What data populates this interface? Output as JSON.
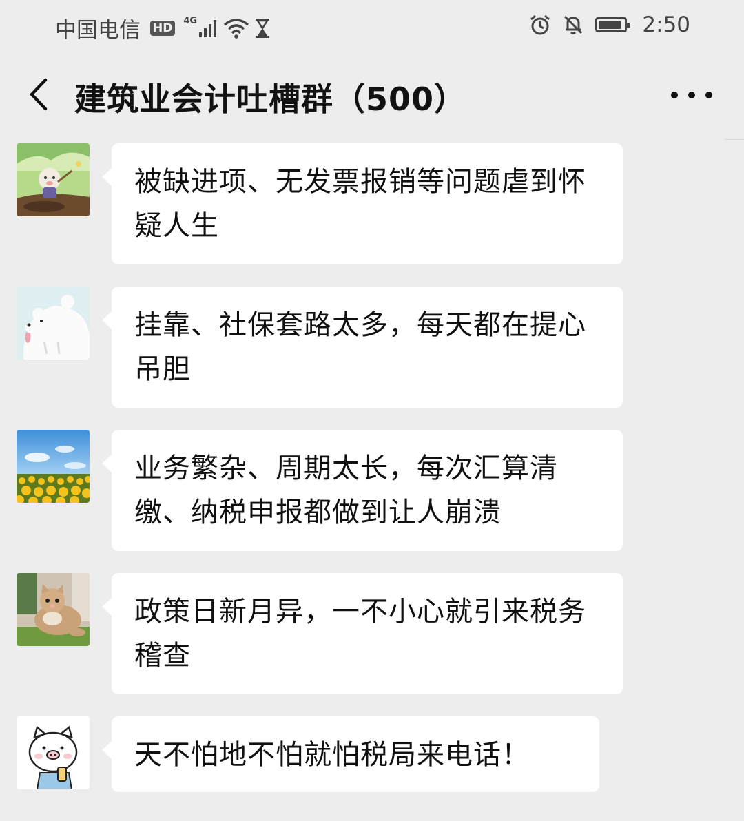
{
  "status_bar": {
    "carrier": "中国电信",
    "hd": "HD",
    "network": "4G",
    "time": "2:50"
  },
  "header": {
    "title": "建筑业会计吐槽群（500）"
  },
  "messages": [
    {
      "avatar": "cartoon-sheep-avatar",
      "text": "被缺进项、无发票报销等问题虐到怀疑人生"
    },
    {
      "avatar": "white-bear-avatar",
      "text": "挂靠、社保套路太多，每天都在提心吊胆"
    },
    {
      "avatar": "sunflower-field-avatar",
      "text": "业务繁杂、周期太长，每次汇算清缴、纳税申报都做到让人崩溃"
    },
    {
      "avatar": "cat-avatar",
      "text": "政策日新月异，一不小心就引来税务稽查"
    },
    {
      "avatar": "pig-cartoon-avatar",
      "text": "天不怕地不怕就怕税局来电话！"
    }
  ],
  "colors": {
    "background": "#ededed",
    "bubble": "#ffffff",
    "text": "#111111"
  }
}
